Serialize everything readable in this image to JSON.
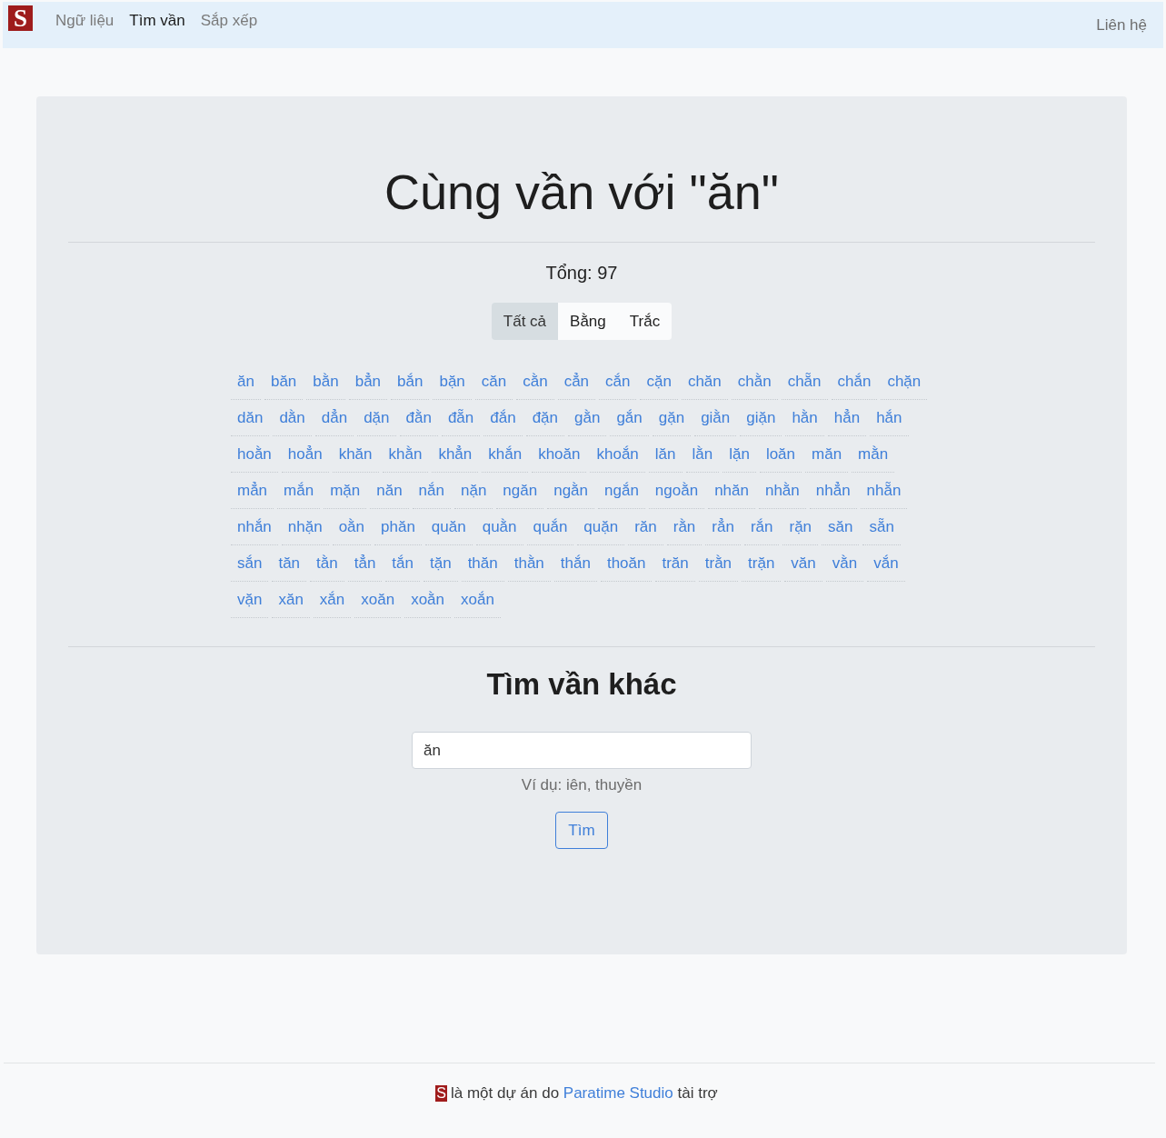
{
  "navbar": {
    "logo": "S",
    "links": [
      {
        "label": "Ngữ liệu",
        "selected": false
      },
      {
        "label": "Tìm vần",
        "selected": true
      },
      {
        "label": "Sắp xếp",
        "selected": false
      }
    ],
    "contact": "Liên hệ"
  },
  "results": {
    "title": "Cùng vần với \"ăn\"",
    "total": "Tổng: 97",
    "filters": [
      {
        "label": "Tất cả",
        "selected": true
      },
      {
        "label": "Bằng",
        "selected": false
      },
      {
        "label": "Trắc",
        "selected": false
      }
    ],
    "words": [
      "ăn",
      "băn",
      "bằn",
      "bẳn",
      "bắn",
      "bặn",
      "căn",
      "cằn",
      "cẳn",
      "cắn",
      "cặn",
      "chăn",
      "chằn",
      "chẵn",
      "chắn",
      "chặn",
      "dăn",
      "dằn",
      "dẳn",
      "dặn",
      "đằn",
      "đẵn",
      "đắn",
      "đặn",
      "gằn",
      "gắn",
      "gặn",
      "giằn",
      "giặn",
      "hằn",
      "hẳn",
      "hắn",
      "hoằn",
      "hoẳn",
      "khăn",
      "khằn",
      "khẳn",
      "khắn",
      "khoăn",
      "khoắn",
      "lăn",
      "lằn",
      "lặn",
      "loăn",
      "măn",
      "mằn",
      "mẳn",
      "mắn",
      "mặn",
      "năn",
      "nắn",
      "nặn",
      "ngăn",
      "ngằn",
      "ngắn",
      "ngoằn",
      "nhăn",
      "nhằn",
      "nhẳn",
      "nhẵn",
      "nhắn",
      "nhặn",
      "oằn",
      "phăn",
      "quăn",
      "quằn",
      "quắn",
      "quặn",
      "răn",
      "rằn",
      "rẳn",
      "rắn",
      "rặn",
      "săn",
      "sẵn",
      "sắn",
      "tăn",
      "tằn",
      "tẳn",
      "tắn",
      "tặn",
      "thăn",
      "thằn",
      "thắn",
      "thoăn",
      "trăn",
      "trằn",
      "trặn",
      "văn",
      "vằn",
      "vắn",
      "vặn",
      "xăn",
      "xắn",
      "xoăn",
      "xoằn",
      "xoắn"
    ]
  },
  "search": {
    "heading": "Tìm vần khác",
    "value": "ăn",
    "hint": "Ví dụ: iên, thuyền",
    "button": "Tìm"
  },
  "footer": {
    "logo": "S",
    "text_before": "là một dự án do",
    "link": "Paratime Studio",
    "text_after": "tài trợ"
  }
}
